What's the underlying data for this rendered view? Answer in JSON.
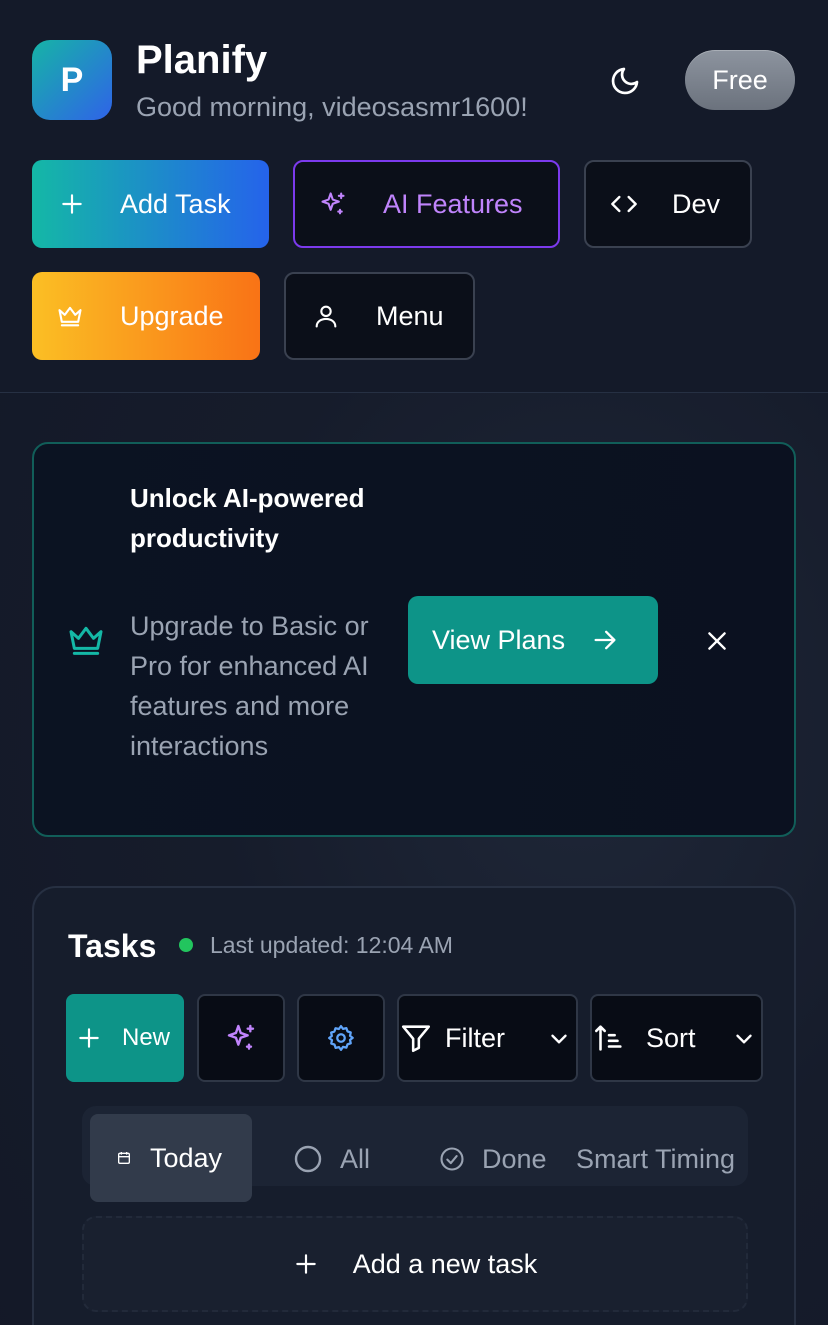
{
  "app": {
    "logo_letter": "P",
    "title": "Planify",
    "greeting": "Good morning, videosasmr1600!"
  },
  "header": {
    "theme_icon": "moon-icon",
    "plan_badge": "Free"
  },
  "actions": {
    "add_task": "Add Task",
    "ai_features": "AI Features",
    "dev": "Dev",
    "upgrade": "Upgrade",
    "menu": "Menu"
  },
  "banner": {
    "title": "Unlock AI-powered productivity",
    "description": "Upgrade to Basic or Pro for enhanced AI features and more interactions",
    "cta": "View Plans"
  },
  "tasks": {
    "title": "Tasks",
    "last_updated": "Last updated: 12:04 AM",
    "toolbar": {
      "new": "New",
      "filter": "Filter",
      "sort": "Sort"
    },
    "tabs": [
      {
        "label": "Today",
        "icon": "calendar-icon",
        "selected": true
      },
      {
        "label": "All",
        "icon": "circle-icon",
        "selected": false
      },
      {
        "label": "Done",
        "icon": "check-circle-icon",
        "selected": false
      },
      {
        "label": "Smart Timing",
        "selected": false
      }
    ],
    "add_new": "Add a new task"
  },
  "colors": {
    "accent_teal": "#0d9488",
    "ai_purple": "#c084fc",
    "upgrade_orange": "#f97316",
    "status_green": "#22c55e"
  }
}
